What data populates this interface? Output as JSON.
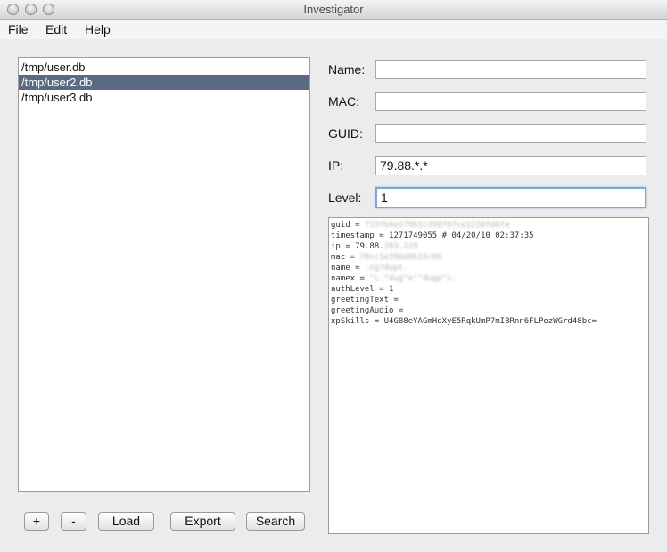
{
  "window": {
    "title": "Investigator"
  },
  "menu": {
    "items": [
      "File",
      "Edit",
      "Help"
    ]
  },
  "db_list": {
    "items": [
      "/tmp/user.db",
      "/tmp/user2.db",
      "/tmp/user3.db"
    ],
    "selected_index": 1
  },
  "buttons": {
    "add": "+",
    "remove": "-",
    "load": "Load",
    "export": "Export",
    "search": "Search"
  },
  "fields": {
    "name": {
      "label": "Name:",
      "value": ""
    },
    "mac": {
      "label": "MAC:",
      "value": ""
    },
    "guid": {
      "label": "GUID:",
      "value": ""
    },
    "ip": {
      "label": "IP:",
      "value": "79.88.*.*"
    },
    "level": {
      "label": "Level:",
      "value": "1"
    }
  },
  "record": {
    "lines": [
      {
        "key": "guid = ",
        "value": "",
        "redacted": "f33fb4a17961c398f07ce1236fd0fa"
      },
      {
        "key": "timestamp = ",
        "value": "1271749055 # 04/20/10 02:37:35",
        "redacted": ""
      },
      {
        "key": "ip = ",
        "value": "79.88.",
        "redacted": "203.119"
      },
      {
        "key": "mac = ",
        "value": "",
        "redacted": "70cc1e39dd8b15c06"
      },
      {
        "key": "name = ",
        "value": "",
        "redacted": ".ng7dupt."
      },
      {
        "key": "namex = ",
        "value": "",
        "redacted": "\"L.\"dug\"e\"\"dugp\"s."
      },
      {
        "key": "authLevel = ",
        "value": "1",
        "redacted": ""
      },
      {
        "key": "greetingText = ",
        "value": "",
        "redacted": ""
      },
      {
        "key": "greetingAudio = ",
        "value": "",
        "redacted": ""
      },
      {
        "key": "xpSkills = ",
        "value": "U4G88eYAGmHqXyE5RqkUmP7mIBRnn6FLPozWGrd48bc=",
        "redacted": ""
      }
    ]
  }
}
